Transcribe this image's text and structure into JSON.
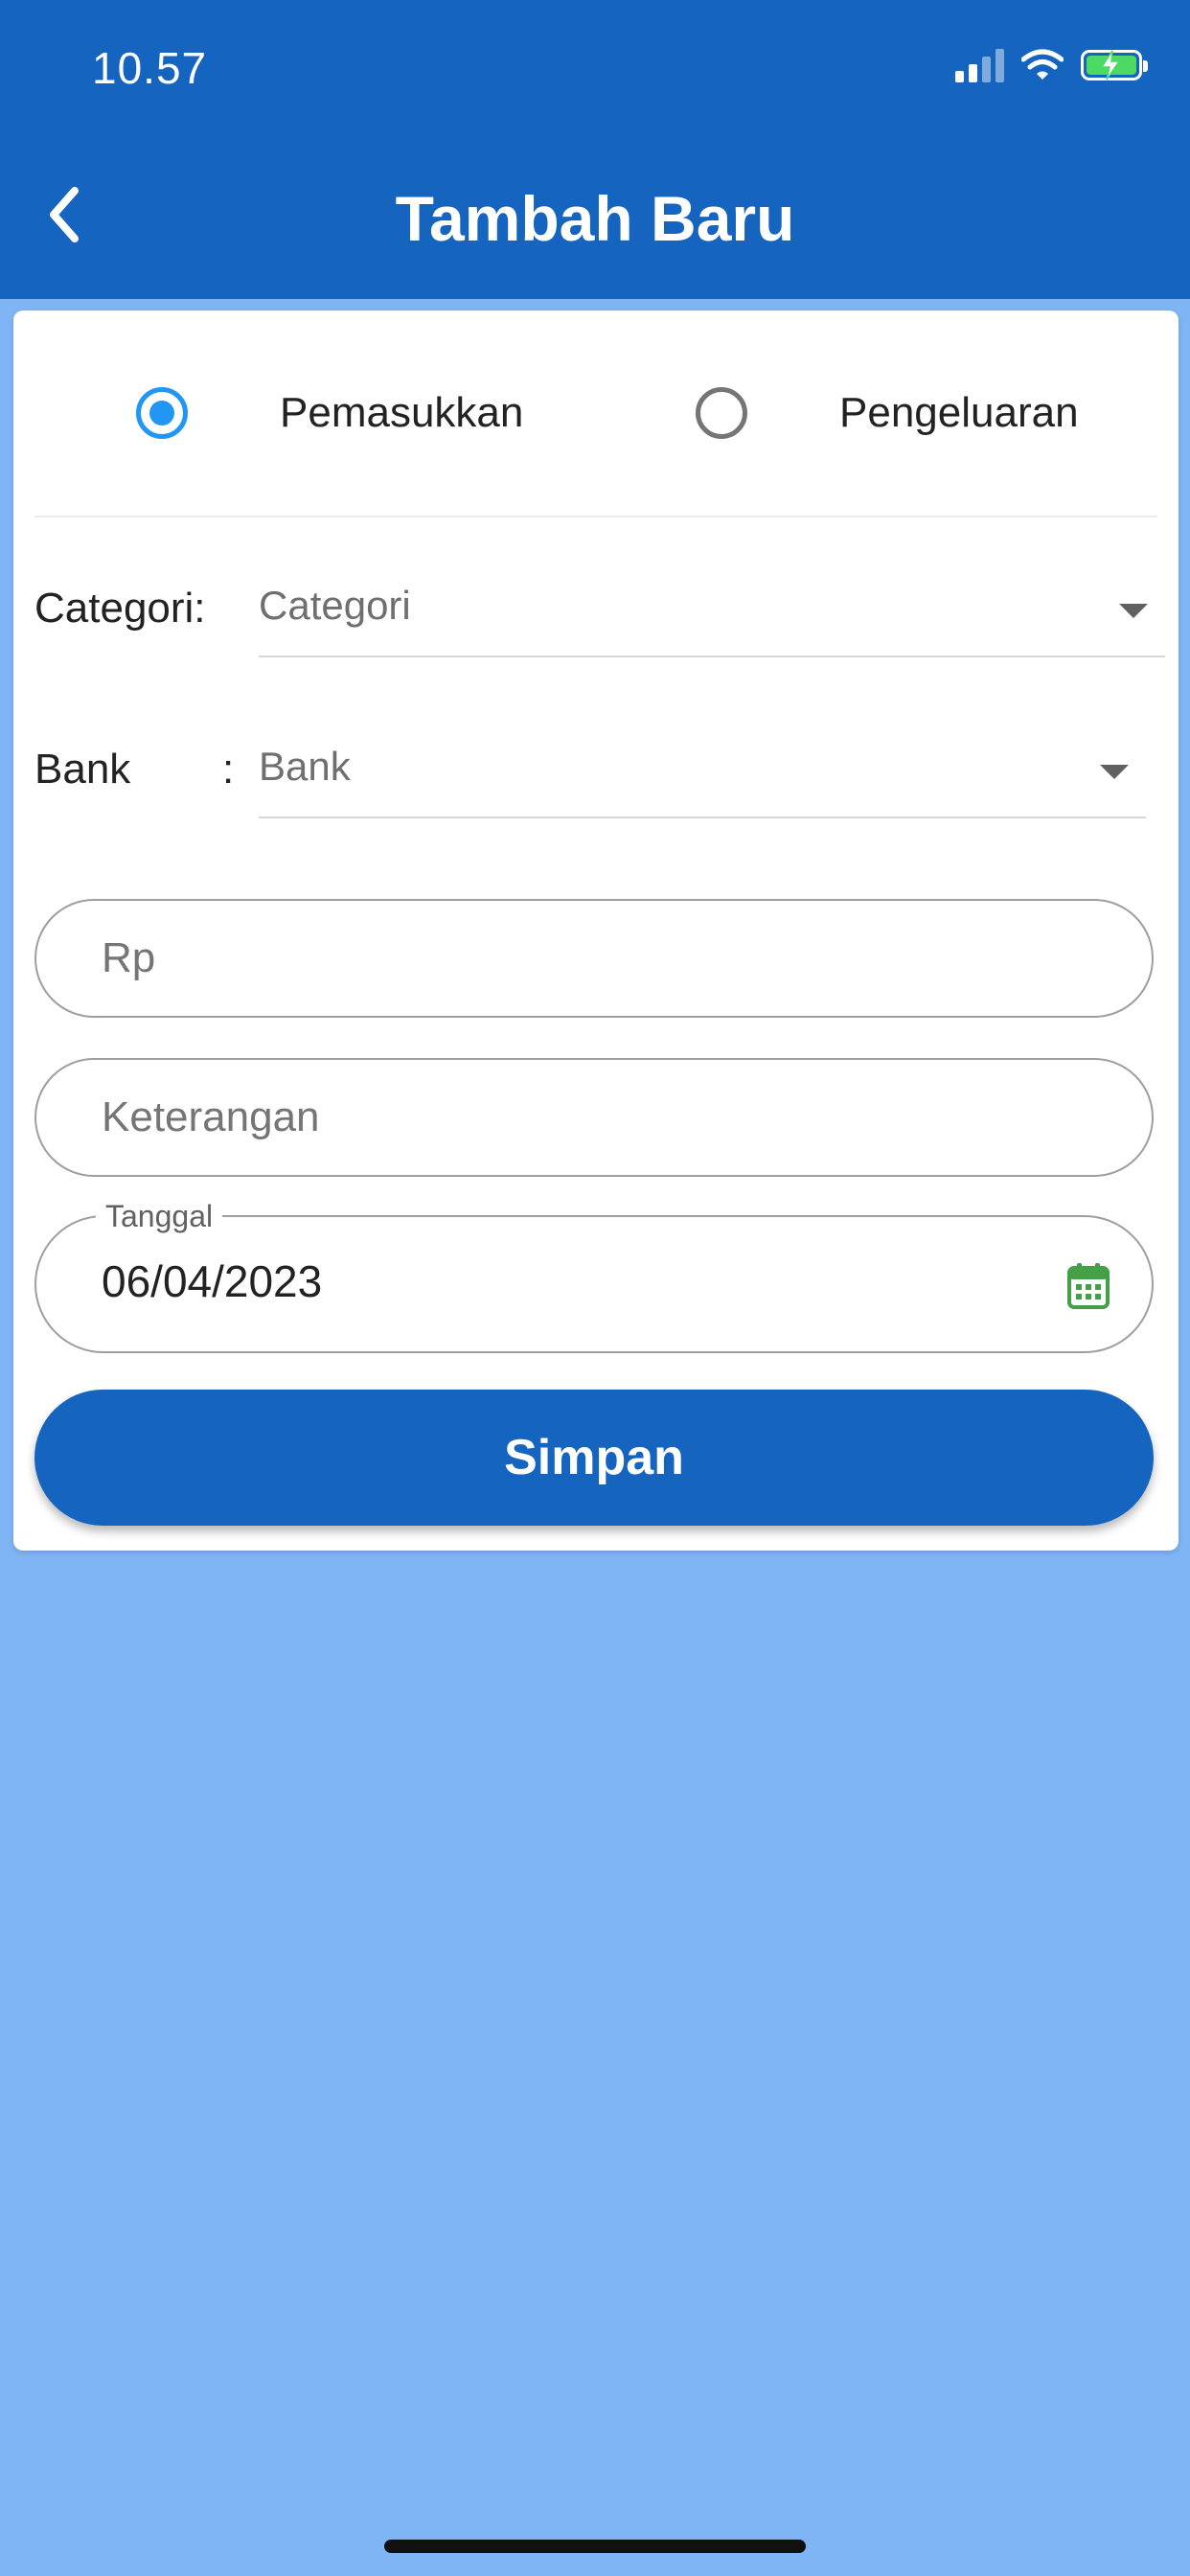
{
  "status_bar": {
    "time": "10.57"
  },
  "header": {
    "title": "Tambah Baru",
    "back_icon": "chevron-left-icon"
  },
  "form": {
    "type_options": [
      {
        "label": "Pemasukkan",
        "selected": true
      },
      {
        "label": "Pengeluaran",
        "selected": false
      }
    ],
    "category": {
      "label": "Categori:",
      "placeholder": "Categori"
    },
    "bank": {
      "label": "Bank",
      "separator": ":",
      "placeholder": "Bank"
    },
    "amount": {
      "placeholder": "Rp",
      "value": ""
    },
    "description": {
      "placeholder": "Keterangan",
      "value": ""
    },
    "date": {
      "label": "Tanggal",
      "value": "06/04/2023",
      "icon": "calendar-icon"
    },
    "save_label": "Simpan"
  },
  "colors": {
    "primary": "#1565c0",
    "background": "#7fb5f5",
    "radio_active": "#2196f3",
    "calendar_icon": "#43a047"
  }
}
